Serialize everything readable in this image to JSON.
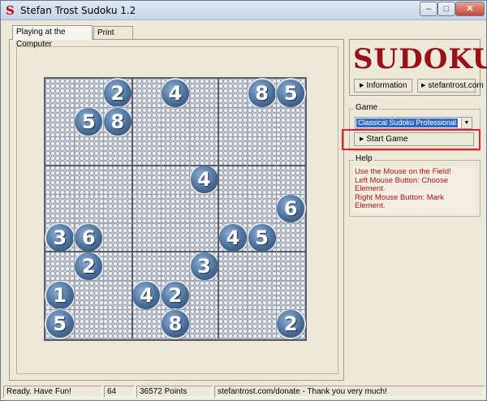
{
  "window": {
    "title": "Stefan Trost Sudoku 1.2",
    "controls": {
      "minimize": "–",
      "maximize": "□",
      "close": "✕"
    }
  },
  "tabs": [
    {
      "label": "Playing at the Computer",
      "active": true
    },
    {
      "label": "Print Mode",
      "active": false
    }
  ],
  "board": {
    "rows": [
      [
        0,
        0,
        2,
        0,
        4,
        0,
        0,
        8,
        5
      ],
      [
        0,
        5,
        8,
        0,
        0,
        0,
        0,
        0,
        0
      ],
      [
        0,
        0,
        0,
        0,
        0,
        0,
        0,
        0,
        0
      ],
      [
        0,
        0,
        0,
        0,
        0,
        4,
        0,
        0,
        0
      ],
      [
        0,
        0,
        0,
        0,
        0,
        0,
        0,
        0,
        6
      ],
      [
        3,
        6,
        0,
        0,
        0,
        0,
        4,
        5,
        0
      ],
      [
        0,
        2,
        0,
        0,
        0,
        3,
        0,
        0,
        0
      ],
      [
        1,
        0,
        0,
        4,
        2,
        0,
        0,
        0,
        0
      ],
      [
        5,
        0,
        0,
        0,
        8,
        0,
        0,
        0,
        2
      ]
    ],
    "candidate_style": "tiny circled digits 1-9"
  },
  "logo": {
    "text": "SUDOKU",
    "color": "#9a1018"
  },
  "links": {
    "information": "Information",
    "website": "stefantrost.com"
  },
  "game": {
    "group_label": "Game",
    "selected_mode": "Classical Sudoku Professional",
    "start_label": "Start Game"
  },
  "help": {
    "group_label": "Help",
    "lines": [
      "Use the Mouse on the Field!",
      "Left Mouse Button: Choose Element.",
      "Right Mouse Button: Mark Element."
    ],
    "color": "#b01010"
  },
  "status": {
    "message": "Ready. Have Fun!",
    "count": "64",
    "points": "36572 Points",
    "donate": "stefantrost.com/donate - Thank you very much!"
  },
  "colors": {
    "highlight": "#e8202a",
    "number_ball": "#4a6f9a",
    "selection": "#316ac5"
  }
}
